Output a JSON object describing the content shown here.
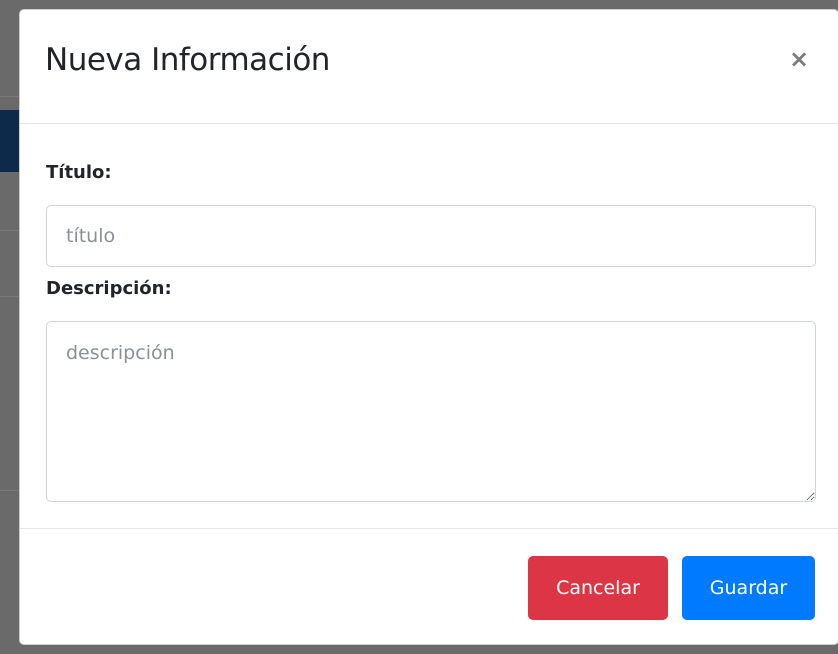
{
  "modal": {
    "title": "Nueva Información",
    "close_label": "×"
  },
  "form": {
    "title_label": "Título:",
    "title_placeholder": "título",
    "title_value": "",
    "description_label": "Descripción:",
    "description_placeholder": "descripción",
    "description_value": ""
  },
  "footer": {
    "cancel_label": "Cancelar",
    "save_label": "Guardar"
  },
  "colors": {
    "cancel": "#dc3545",
    "save": "#007bff",
    "overlay": "#5c5c5c"
  }
}
